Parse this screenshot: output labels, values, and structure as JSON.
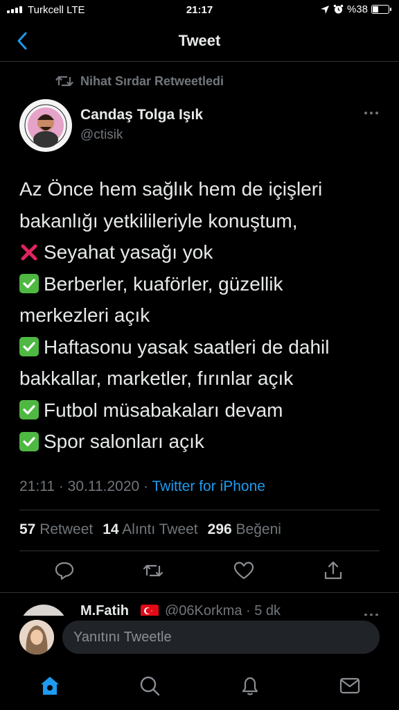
{
  "status_bar": {
    "carrier": "Turkcell  LTE",
    "time": "21:17",
    "battery_text": "%38",
    "battery_level": 0.38
  },
  "header": {
    "title": "Tweet"
  },
  "retweet_context": {
    "text": "Nihat Sırdar Retweetledi"
  },
  "tweet": {
    "author_name": "Candaş Tolga Işık",
    "author_handle": "@ctisik",
    "lines": [
      "Az Önce hem sağlık hem de içişleri",
      "bakanlığı yetkilileriyle konuştum,",
      "Seyahat yasağı yok",
      "Berberler, kuaförler, güzellik",
      "merkezleri açık",
      "Haftasonu yasak saatleri de dahil",
      "bakkallar, marketler, fırınlar açık",
      "Futbol müsabakaları devam",
      "Spor salonları açık"
    ],
    "time": "21:11",
    "date": "30.11.2020",
    "source": "Twitter for iPhone",
    "stats": {
      "retweets": "57",
      "retweets_label": "Retweet",
      "quotes": "14",
      "quotes_label": "Alıntı Tweet",
      "likes": "296",
      "likes_label": "Beğeni"
    }
  },
  "reply_preview": {
    "name": "M.Fatih",
    "handle_meta": "@06Korkma · 5 dk"
  },
  "composer": {
    "placeholder": "Yanıtını Tweetle"
  },
  "colors": {
    "accent": "#1d9bf0",
    "check": "#4fb843",
    "cross": "#e0245e"
  }
}
